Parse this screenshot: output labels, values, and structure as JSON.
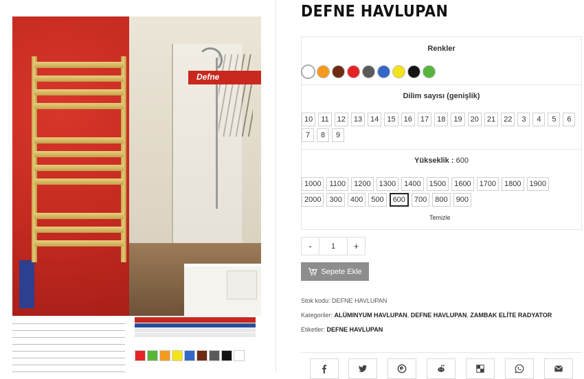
{
  "product": {
    "title": "DEFNE HAVLUPAN",
    "image_brand_label": "Defne"
  },
  "options": {
    "colors_heading": "Renkler",
    "colors": [
      {
        "name": "Beyaz",
        "hex": "#ffffff",
        "selected": true
      },
      {
        "name": "Turuncu",
        "hex": "#f39a1f"
      },
      {
        "name": "Kahverengi",
        "hex": "#6e2a14"
      },
      {
        "name": "Kırmızı",
        "hex": "#e52325"
      },
      {
        "name": "Antrasit",
        "hex": "#5a5a5a"
      },
      {
        "name": "Mavi",
        "hex": "#3567c6"
      },
      {
        "name": "Sarı",
        "hex": "#f2e31a"
      },
      {
        "name": "Siyah",
        "hex": "#141414"
      },
      {
        "name": "Yeşil",
        "hex": "#59b43c"
      }
    ],
    "slices_heading": "Dilim sayısı (genişlik)",
    "slices": [
      "10",
      "11",
      "12",
      "13",
      "14",
      "15",
      "16",
      "17",
      "18",
      "19",
      "20",
      "21",
      "22",
      "3",
      "4",
      "5",
      "6",
      "7",
      "8",
      "9"
    ],
    "height_heading": "Yükseklik",
    "height_selected": "600",
    "heights": [
      "1000",
      "1100",
      "1200",
      "1300",
      "1400",
      "1500",
      "1600",
      "1700",
      "1800",
      "1900",
      "2000",
      "300",
      "400",
      "500",
      "600",
      "700",
      "800",
      "900"
    ],
    "clear_label": "Temizle"
  },
  "cart": {
    "minus_label": "-",
    "quantity": "1",
    "plus_label": "+",
    "add_label": "Sepete Ekle"
  },
  "meta": {
    "sku_label": "Stok kodu:",
    "sku_value": "DEFNE HAVLUPAN",
    "categories_label": "Kategoriler:",
    "categories": [
      "ALÜMINYUM HAVLUPAN",
      "DEFNE HAVLUPAN",
      "ZAMBAK ELİTE RADYATOR"
    ],
    "tags_label": "Etiketler:",
    "tags": [
      "DEFNE HAVLUPAN"
    ]
  },
  "share": [
    "facebook-icon",
    "twitter-icon",
    "pinterest-icon",
    "reddit-icon",
    "delicious-icon",
    "whatsapp-icon",
    "email-icon"
  ]
}
